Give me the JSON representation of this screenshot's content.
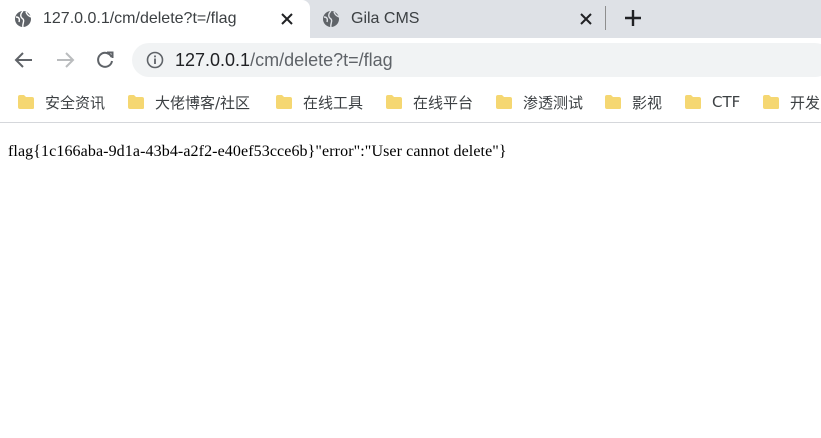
{
  "tabs": [
    {
      "title": "127.0.0.1/cm/delete?t=/flag",
      "favicon": "globe-icon",
      "active": true
    },
    {
      "title": "Gila CMS",
      "favicon": "globe-icon",
      "active": false
    }
  ],
  "toolbar": {
    "back_icon": "arrow-left-icon",
    "forward_icon": "arrow-right-icon",
    "reload_icon": "reload-icon",
    "address": {
      "host": "127.0.0.1",
      "path": "/cm/delete?t=/flag",
      "security_icon": "info-icon"
    }
  },
  "bookmarks": [
    {
      "label": "安全资讯"
    },
    {
      "label": "大佬博客/社区"
    },
    {
      "label": "在线工具"
    },
    {
      "label": "在线平台"
    },
    {
      "label": "渗透测试"
    },
    {
      "label": "影视"
    },
    {
      "label": "CTF"
    },
    {
      "label": "开发"
    }
  ],
  "page": {
    "body_text": "flag{1c166aba-9d1a-43b4-a2f2-e40ef53cce6b}\"error\":\"User cannot delete\"}"
  },
  "colors": {
    "tabstrip": "#dee1e6",
    "omnibox": "#f1f3f4",
    "folder": "#f5d772",
    "text": "#3c4043"
  }
}
